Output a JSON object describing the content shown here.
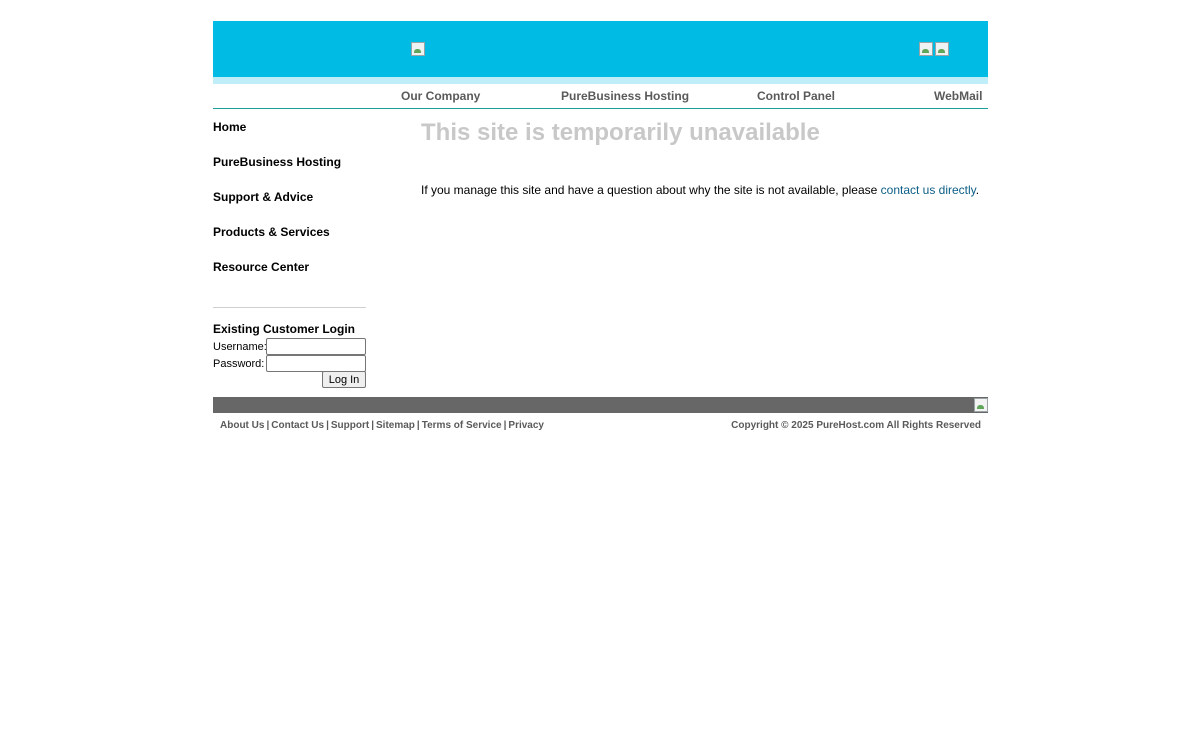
{
  "header": {
    "logo_icon": "broken-image-icon",
    "corner_icons": [
      "broken-image-icon",
      "broken-image-icon"
    ],
    "banner_color": "#00bce4",
    "strip_color": "#bfeef9"
  },
  "topnav": {
    "items": [
      {
        "label": "Our Company"
      },
      {
        "label": "PureBusiness Hosting"
      },
      {
        "label": "Control Panel"
      },
      {
        "label": "WebMail"
      }
    ]
  },
  "sidebar": {
    "items": [
      {
        "label": "Home"
      },
      {
        "label": "PureBusiness Hosting"
      },
      {
        "label": "Support & Advice"
      },
      {
        "label": "Products & Services"
      },
      {
        "label": "Resource Center"
      }
    ]
  },
  "login": {
    "title": "Existing Customer Login",
    "username_label": "Username:",
    "username_value": "",
    "password_label": "Password:",
    "password_value": "",
    "button_label": "Log In"
  },
  "main": {
    "headline": "This site is temporarily unavailable",
    "message_prefix": "If you manage this site and have a question about why the site is not available, please ",
    "message_link": "contact us directly",
    "message_suffix": "."
  },
  "footer": {
    "links": [
      {
        "label": "About Us"
      },
      {
        "label": "Contact Us"
      },
      {
        "label": "Support"
      },
      {
        "label": "Sitemap"
      },
      {
        "label": "Terms of Service"
      },
      {
        "label": "Privacy"
      }
    ],
    "separator": "|",
    "copyright": "Copyright © 2025 PureHost.com All Rights Reserved",
    "bar_color": "#676767"
  }
}
